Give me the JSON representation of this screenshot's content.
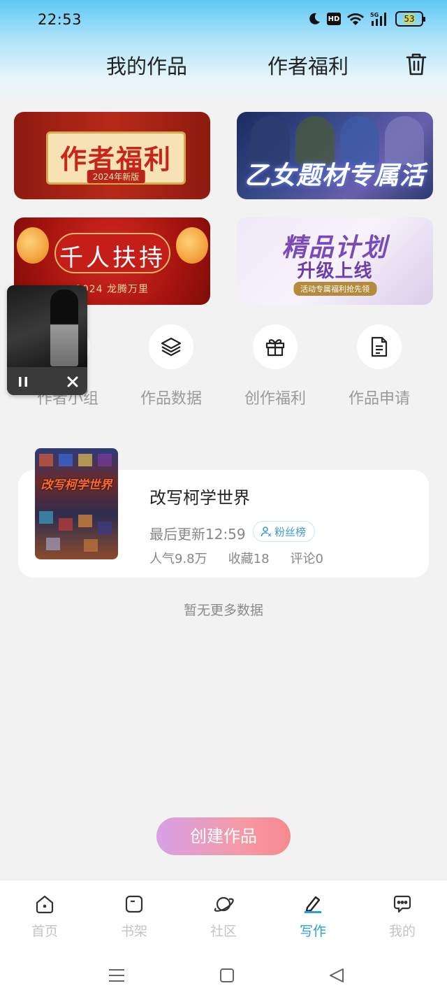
{
  "status_bar": {
    "time": "22:53",
    "battery_level": "53",
    "icons": [
      "moon-icon",
      "hd-icon",
      "wifi-icon",
      "5g-signal-icon",
      "battery-icon"
    ]
  },
  "header": {
    "tabs": [
      {
        "label": "我的作品",
        "active": true
      },
      {
        "label": "作者福利",
        "active": false
      }
    ],
    "trash_icon": "trash-icon"
  },
  "banners": [
    {
      "title": "作者福利",
      "subtitle": "2024年新版"
    },
    {
      "title": "乙女题材专属活动"
    },
    {
      "title": "千人扶持",
      "subtitle": "2024 龙腾万里"
    },
    {
      "title": "精品计划",
      "subtitle": "升级上线",
      "tag": "活动专属福利抢先领"
    }
  ],
  "quick_entries": [
    {
      "label": "作者小组",
      "icon": "group-icon"
    },
    {
      "label": "作品数据",
      "icon": "layers-icon"
    },
    {
      "label": "创作福利",
      "icon": "gift-icon"
    },
    {
      "label": "作品申请",
      "icon": "document-icon"
    }
  ],
  "mini_player": {
    "pause_icon": "pause-icon",
    "close_icon": "close-icon"
  },
  "works": [
    {
      "cover_title": "改写柯学世界",
      "title": "改写柯学世界",
      "last_update": "最后更新12:59",
      "badge": "粉丝榜",
      "popularity": "人气9.8万",
      "favorites": "收藏18",
      "comments": "评论0"
    }
  ],
  "no_more_text": "暂无更多数据",
  "create_button": "创建作品",
  "bottom_nav": [
    {
      "label": "首页",
      "icon": "home-icon",
      "active": false
    },
    {
      "label": "书架",
      "icon": "bookshelf-icon",
      "active": false
    },
    {
      "label": "社区",
      "icon": "planet-icon",
      "active": false
    },
    {
      "label": "写作",
      "icon": "pen-icon",
      "active": true
    },
    {
      "label": "我的",
      "icon": "chat-bubble-icon",
      "active": false
    }
  ],
  "colors": {
    "accent": "#2a9fe0",
    "create_gradient_start": "#d7a0e8",
    "create_gradient_end": "#f78a8e",
    "inactive_nav": "#c4c4c4"
  }
}
